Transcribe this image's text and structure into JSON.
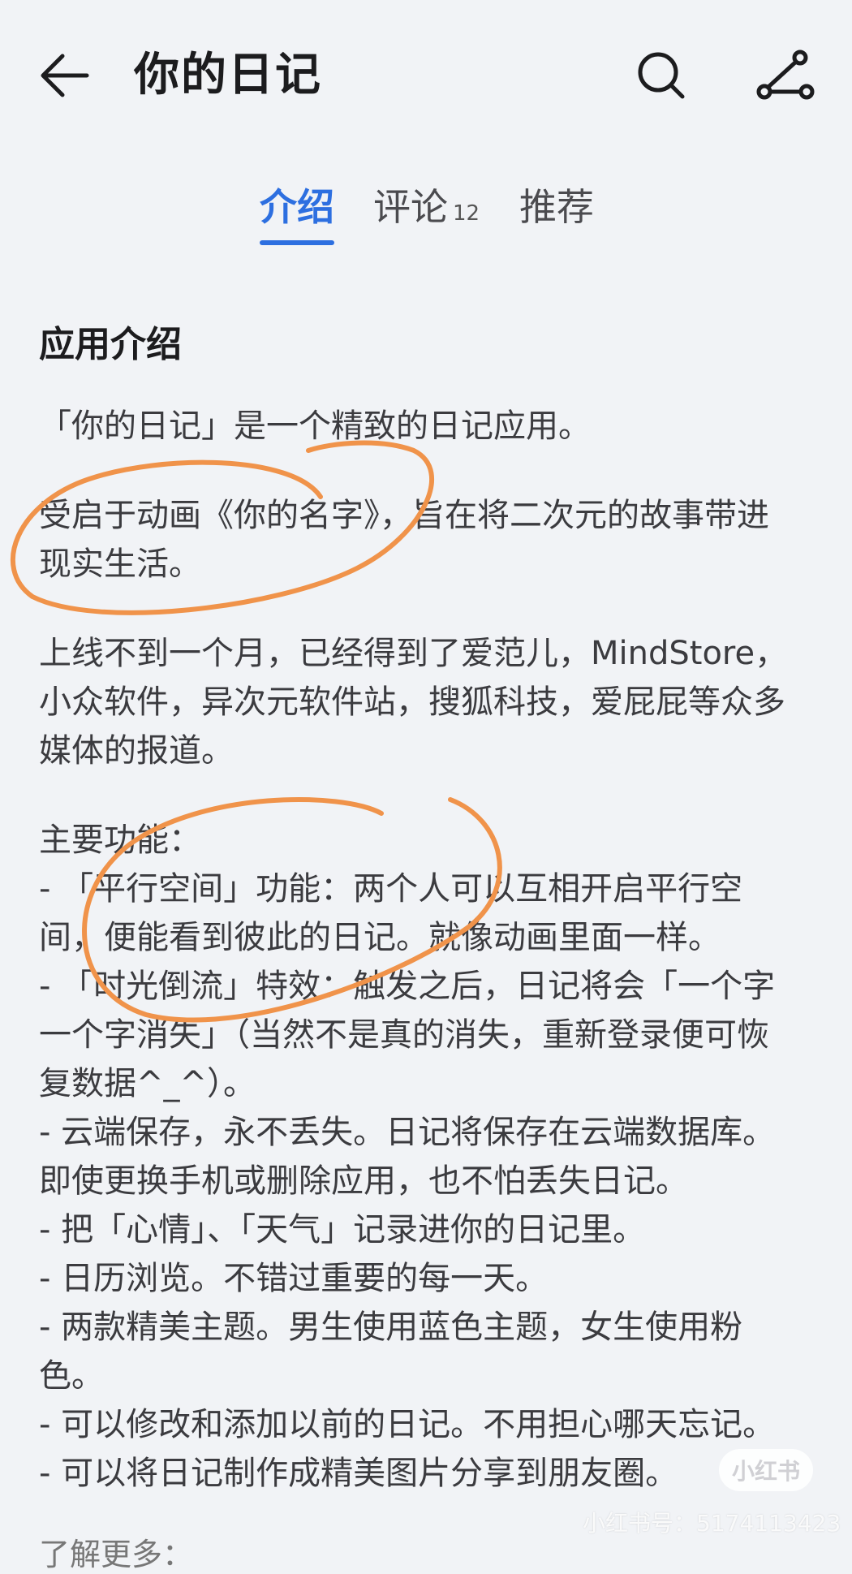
{
  "header": {
    "title": "你的日记",
    "back_icon": "arrow-left-icon",
    "search_icon": "search-icon",
    "share_icon": "share-icon"
  },
  "tabs": [
    {
      "label": "介绍",
      "active": true
    },
    {
      "label": "评论",
      "count": "12",
      "active": false
    },
    {
      "label": "推荐",
      "active": false
    }
  ],
  "intro": {
    "section_title": "应用介绍",
    "para1": "「你的日记」是一个精致的日记应用。",
    "para2": [
      "受启于动画《你的名字》，旨在将二次元的故事带进",
      "现实生活。"
    ],
    "para3": [
      "上线不到一个月，已经得到了爱范儿，MindStore，",
      "小众软件，异次元软件站，搜狐科技，爱屁屁等众多",
      "媒体的报道。"
    ],
    "features": [
      "主要功能：",
      "- 「平行空间」功能：两个人可以互相开启平行空",
      "间，便能看到彼此的日记。就像动画里面一样。",
      "- 「时光倒流」特效：触发之后，日记将会「一个字",
      "一个字消失」（当然不是真的消失，重新登录便可恢",
      "复数据^_^）。",
      "- 云端保存，永不丢失。日记将保存在云端数据库。",
      "即使更换手机或删除应用，也不怕丢失日记。",
      "- 把「心情」、「天气」记录进你的日记里。",
      "- 日历浏览。不错过重要的每一天。",
      "- 两款精美主题。男生使用蓝色主题，女生使用粉",
      "色。",
      "- 可以修改和添加以前的日记。不用担心哪天忘记。",
      "- 可以将日记制作成精美图片分享到朋友圈。"
    ],
    "more_label": "了解更多："
  },
  "watermark": {
    "badge": "小红书",
    "id_text": "小红书号：5174113423"
  },
  "colors": {
    "accent": "#2d6fe0",
    "annotation": "#f0934a",
    "background": "#f1f3f6"
  }
}
